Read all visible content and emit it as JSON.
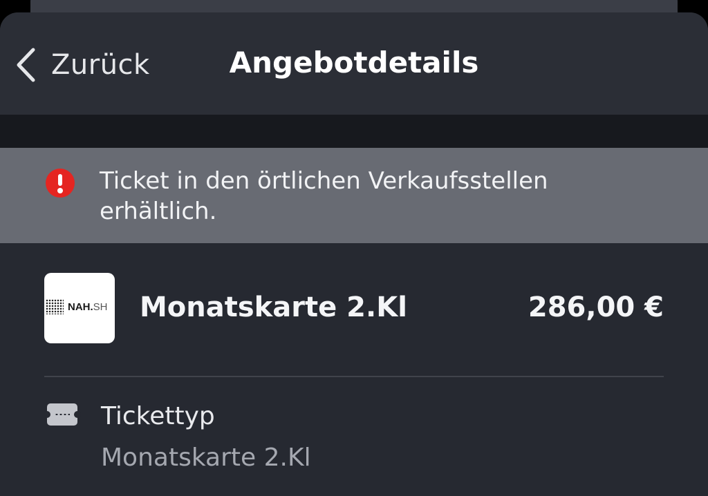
{
  "nav": {
    "back_label": "Zurück",
    "title": "Angebotdetails"
  },
  "notice": {
    "icon": "exclamation-circle-icon",
    "line1": "Ticket in den örtlichen Verkaufsstellen",
    "line2": "erhältlich.",
    "icon_color": "#e52521"
  },
  "offer": {
    "logo_text": "NAH.",
    "logo_text_suffix": "SH",
    "name": "Monatskarte 2.Kl",
    "price": "286,00 €"
  },
  "details": [
    {
      "icon": "ticket-icon",
      "label": "Tickettyp",
      "value": "Monatskarte 2.Kl"
    }
  ],
  "colors": {
    "background": "#262931",
    "notice_background": "#686b73",
    "text_primary": "#f4f5f7",
    "text_secondary": "#a5a8b0"
  }
}
